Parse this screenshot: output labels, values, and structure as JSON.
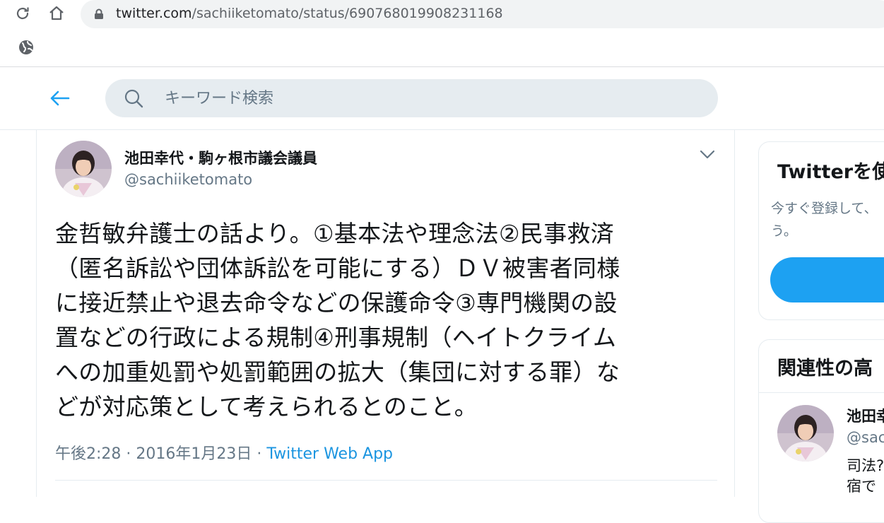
{
  "browser": {
    "url_host": "twitter.com",
    "url_path": "/sachiiketomato/status/690768019908231168"
  },
  "header": {
    "search_placeholder": "キーワード検索"
  },
  "tweet": {
    "author_name": "池田幸代・駒ヶ根市議会議員",
    "author_handle": "@sachiiketomato",
    "text_lines": [
      "金哲敏弁護士の話より。①基本法や理念法②民事救済",
      "（匿名訴訟や団体訴訟を可能にする）ＤＶ被害者同様",
      "に接近禁止や退去命令などの保護命令③専門機関の設",
      "置などの行政による規制④刑事規制（ヘイトクライム",
      "への加重処罰や処罰範囲の拡大（集団に対する罪）な",
      "どが対応策として考えられるとのこと。"
    ],
    "time": "午後2:28 · 2016年1月23日 · ",
    "source": "Twitter Web App"
  },
  "sidebar": {
    "signup_card": {
      "title": "Twitterを使",
      "desc": "今すぐ登録して、\nう。"
    },
    "related_card": {
      "title": "関連性の高",
      "user_name": "池田幸",
      "user_handle": "@sac",
      "user_bio": "司法?\n宿で"
    }
  },
  "colors": {
    "accent": "#1da1f2",
    "link": "#1b95e0",
    "secondary_text": "#657786",
    "search_bg": "#e6ecf0"
  }
}
